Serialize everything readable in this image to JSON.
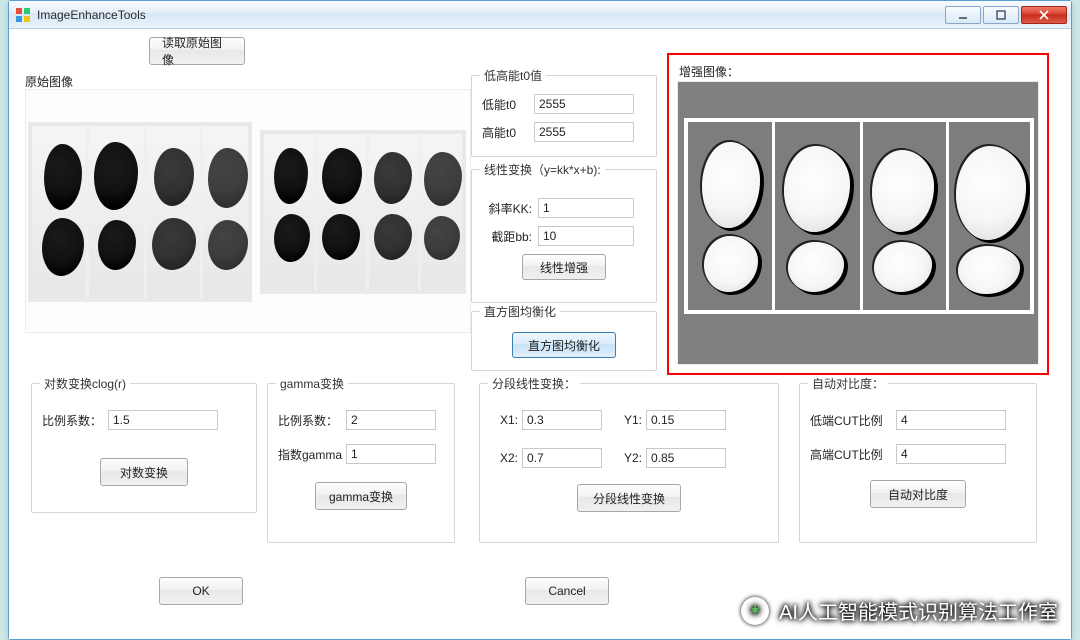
{
  "window": {
    "title": "ImageEnhanceTools"
  },
  "labels": {
    "original_image": "原始图像",
    "load_original_btn": "读取原始图像",
    "enhanced_image": "增强图像：",
    "t0_group": "低高能t0值",
    "low_t0_label": "低能t0",
    "high_t0_label": "高能t0",
    "linear_group": "线性变换（y=kk*x+b):",
    "slope_label": "斜率KK:",
    "intercept_label": "截距bb:",
    "linear_enhance_btn": "线性增强",
    "hist_group": "直方图均衡化",
    "hist_btn": "直方图均衡化",
    "log_group": "对数变换clog(r)",
    "log_coef_label": "比例系数：",
    "log_btn": "对数变换",
    "gamma_group": "gamma变换",
    "gamma_coef_label": "比例系数：",
    "gamma_exp_label": "指数gamma",
    "gamma_btn": "gamma变换",
    "piecewise_group": "分段线性变换：",
    "x1_label": "X1:",
    "y1_label": "Y1:",
    "x2_label": "X2:",
    "y2_label": "Y2:",
    "piecewise_btn": "分段线性变换",
    "auto_group": "自动对比度：",
    "low_cut_label": "低端CUT比例",
    "high_cut_label": "高端CUT比例",
    "auto_btn": "自动对比度",
    "ok_btn": "OK",
    "cancel_btn": "Cancel"
  },
  "values": {
    "low_t0": "2555",
    "high_t0": "2555",
    "slope_kk": "1",
    "intercept_bb": "10",
    "log_coef": "1.5",
    "gamma_coef": "2",
    "gamma_exp": "1",
    "x1": "0.3",
    "y1": "0.15",
    "x2": "0.7",
    "y2": "0.85",
    "low_cut": "4",
    "high_cut": "4"
  },
  "watermark": {
    "text": "AI人工智能模式识别算法工作室"
  }
}
